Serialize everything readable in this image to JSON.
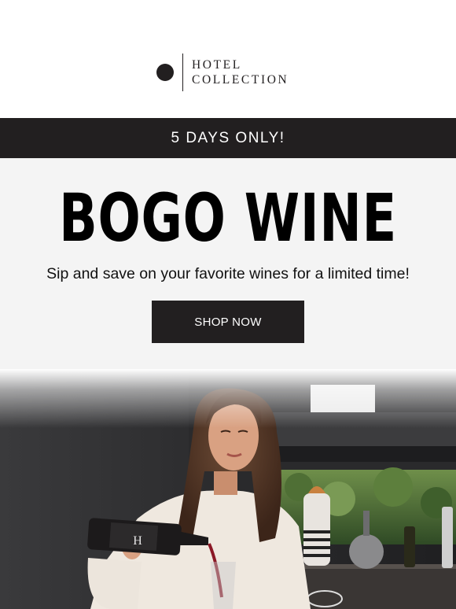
{
  "brand": {
    "line1": "HOTEL",
    "line2": "COLLECTION"
  },
  "banner": {
    "text": "5 DAYS ONLY!"
  },
  "hero": {
    "title": "BOGO WINE",
    "subtitle": "Sip and save on your favorite wines for a limited time!",
    "cta_label": "SHOP NOW"
  },
  "photo": {
    "bottle_label": "H"
  },
  "colors": {
    "dark": "#221f20",
    "hero_bg": "#f4f4f4",
    "white": "#ffffff"
  }
}
